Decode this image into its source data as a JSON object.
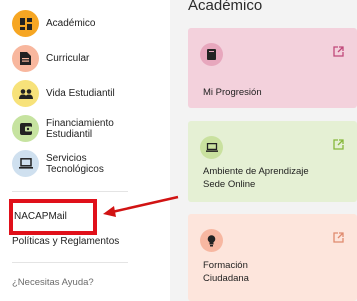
{
  "sidebar": {
    "items": [
      {
        "label": "Académico",
        "icon": "grid-icon",
        "color": "#f6a623"
      },
      {
        "label": "Curricular",
        "icon": "document-icon",
        "color": "#f8b79e"
      },
      {
        "label": "Vida Estudiantil",
        "icon": "people-icon",
        "color": "#f7e27a"
      },
      {
        "label": "Financiamiento Estudiantil",
        "icon": "money-icon",
        "color": "#c6e3a0"
      },
      {
        "label": "Servicios Tecnológicos",
        "icon": "laptop-icon",
        "color": "#cfe0ef"
      }
    ],
    "links": {
      "nacap_mail": "NACAPMail",
      "policies": "Políticas y Reglamentos"
    },
    "help": "¿Necesitas Ayuda?"
  },
  "main": {
    "title": "Académico",
    "cards": [
      {
        "title": "Mi Progresión",
        "icon": "book-icon",
        "bg": "#f3d1dc",
        "icon_bg": "#e7a7bd",
        "ext_color": "#c0487a"
      },
      {
        "title": "Ambiente de Aprendizaje Sede Online",
        "icon": "laptop-icon",
        "bg": "#e5f0d4",
        "icon_bg": "#c9e19f",
        "ext_color": "#86b83a"
      },
      {
        "title": "Formación Ciudadana",
        "icon": "lightbulb-icon",
        "bg": "#fde5dc",
        "icon_bg": "#f7b7a1",
        "ext_color": "#e08a6e"
      }
    ]
  },
  "annotation": {
    "box_color": "#e0101a",
    "arrow_color": "#d11313"
  }
}
